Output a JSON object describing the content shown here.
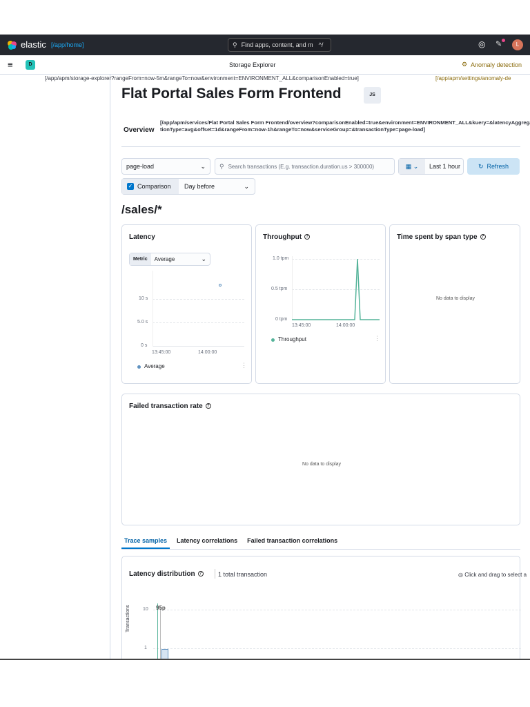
{
  "header": {
    "brand": "elastic",
    "brand_link": "[/app/home]",
    "search_placeholder": "Find apps, content, and m",
    "search_shortcut": "^/",
    "avatar_initial": "L"
  },
  "nav": {
    "space_badge": "D",
    "title": "Storage Explorer",
    "anomaly_label": "Anomaly detection",
    "storage_link": "[/app/apm/storage-explorer?rangeFrom=now-5m&rangeTo=now&environment=ENVIRONMENT_ALL&comparisonEnabled=true]",
    "anomaly_link": "[/app/apm/settings/anomaly-de"
  },
  "service": {
    "name": "Flat Portal Sales Form Frontend",
    "agent_badge": "JS"
  },
  "tabs": {
    "overview_label": "Overview",
    "overview_link": "[/app/apm/services/Flat Portal Sales Form Frontend/overview?comparisonEnabled=true&environment=ENVIRONMENT_ALL&kuery=&latencyAggregationType=avg&offset=1d&rangeFrom=now-1h&rangeTo=now&serviceGroup=&transactionType=page-load]"
  },
  "filters": {
    "transaction_type": "page-load",
    "search_placeholder": "Search transactions (E.g. transaction.duration.us > 300000)",
    "time_range": "Last 1 hour",
    "refresh": "Refresh",
    "comparison_label": "Comparison",
    "comparison_checked": true,
    "comparison_value": "Day before"
  },
  "transaction_name": "/sales/*",
  "latency": {
    "title": "Latency",
    "metric_label": "Metric",
    "metric_value": "Average",
    "legend": "Average",
    "color": "#6092c0",
    "chart_data": {
      "type": "scatter",
      "x_ticks": [
        "13:45:00",
        "14:00:00"
      ],
      "y_ticks": [
        "10 s",
        "5.0 s",
        "0 s"
      ],
      "points": [
        {
          "x": "14:05:00",
          "y": 13
        }
      ]
    }
  },
  "throughput": {
    "title": "Throughput",
    "legend": "Throughput",
    "color": "#54b399",
    "chart_data": {
      "type": "line",
      "x_ticks": [
        "13:45:00",
        "14:00:00"
      ],
      "y_ticks": [
        "1.0 tpm",
        "0.5 tpm",
        "0 tpm"
      ],
      "peak_value": 1.0,
      "baseline": 0
    }
  },
  "span_type": {
    "title": "Time spent by span type",
    "empty": "No data to display"
  },
  "failed_rate": {
    "title": "Failed transaction rate",
    "empty": "No data to display"
  },
  "detail_tabs": [
    "Trace samples",
    "Latency correlations",
    "Failed transaction correlations"
  ],
  "distribution": {
    "title": "Latency distribution",
    "total": "1 total transaction",
    "hint": "Click and drag to select a",
    "percentile_label": "95p",
    "y_axis_label": "Transactions",
    "y_ticks": [
      "10",
      "1"
    ],
    "chart_data": {
      "type": "bar",
      "y_ticks": [
        10,
        1
      ],
      "values": [
        1
      ]
    }
  }
}
